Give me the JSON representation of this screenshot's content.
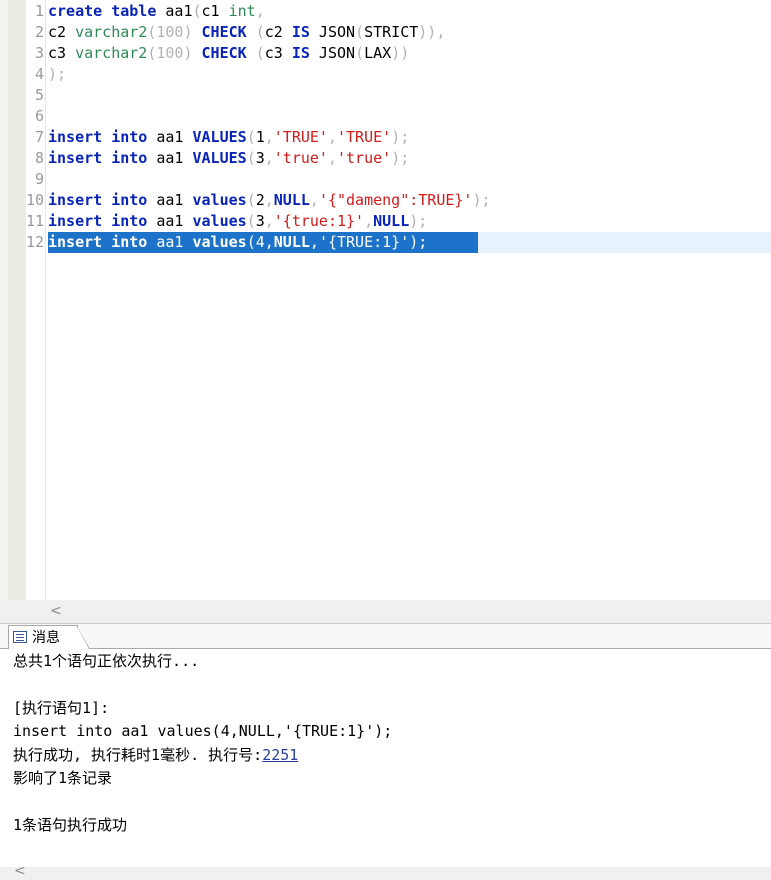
{
  "editor": {
    "lines": [
      {
        "num": "1",
        "tokens": [
          {
            "t": "create",
            "c": "kw"
          },
          {
            "t": " ",
            "c": ""
          },
          {
            "t": "table",
            "c": "kw"
          },
          {
            "t": " aa1",
            "c": ""
          },
          {
            "t": "(",
            "c": "pu"
          },
          {
            "t": "c1 ",
            "c": ""
          },
          {
            "t": "int",
            "c": "ty"
          },
          {
            "t": ",",
            "c": "pu"
          }
        ]
      },
      {
        "num": "2",
        "tokens": [
          {
            "t": "c2 ",
            "c": ""
          },
          {
            "t": "varchar2",
            "c": "ty"
          },
          {
            "t": "(100) ",
            "c": "pu"
          },
          {
            "t": "CHECK",
            "c": "kw"
          },
          {
            "t": " (",
            "c": "pu"
          },
          {
            "t": "c2 ",
            "c": ""
          },
          {
            "t": "IS",
            "c": "kw"
          },
          {
            "t": " JSON",
            "c": ""
          },
          {
            "t": "(",
            "c": "pu"
          },
          {
            "t": "STRICT",
            "c": ""
          },
          {
            "t": ")),",
            "c": "pu"
          }
        ]
      },
      {
        "num": "3",
        "tokens": [
          {
            "t": "c3 ",
            "c": ""
          },
          {
            "t": "varchar2",
            "c": "ty"
          },
          {
            "t": "(100) ",
            "c": "pu"
          },
          {
            "t": "CHECK",
            "c": "kw"
          },
          {
            "t": " (",
            "c": "pu"
          },
          {
            "t": "c3 ",
            "c": ""
          },
          {
            "t": "IS",
            "c": "kw"
          },
          {
            "t": " JSON",
            "c": ""
          },
          {
            "t": "(",
            "c": "pu"
          },
          {
            "t": "LAX",
            "c": ""
          },
          {
            "t": "))",
            "c": "pu"
          }
        ]
      },
      {
        "num": "4",
        "tokens": [
          {
            "t": ");",
            "c": "pu"
          }
        ]
      },
      {
        "num": "5",
        "tokens": []
      },
      {
        "num": "6",
        "tokens": []
      },
      {
        "num": "7",
        "tokens": [
          {
            "t": "insert",
            "c": "kw"
          },
          {
            "t": " ",
            "c": ""
          },
          {
            "t": "into",
            "c": "kw"
          },
          {
            "t": " aa1 ",
            "c": ""
          },
          {
            "t": "VALUES",
            "c": "kw"
          },
          {
            "t": "(",
            "c": "pu"
          },
          {
            "t": "1",
            "c": ""
          },
          {
            "t": ",",
            "c": "pu"
          },
          {
            "t": "'TRUE'",
            "c": "st"
          },
          {
            "t": ",",
            "c": "pu"
          },
          {
            "t": "'TRUE'",
            "c": "st"
          },
          {
            "t": ");",
            "c": "pu"
          }
        ]
      },
      {
        "num": "8",
        "tokens": [
          {
            "t": "insert",
            "c": "kw"
          },
          {
            "t": " ",
            "c": ""
          },
          {
            "t": "into",
            "c": "kw"
          },
          {
            "t": " aa1 ",
            "c": ""
          },
          {
            "t": "VALUES",
            "c": "kw"
          },
          {
            "t": "(",
            "c": "pu"
          },
          {
            "t": "3",
            "c": ""
          },
          {
            "t": ",",
            "c": "pu"
          },
          {
            "t": "'true'",
            "c": "st"
          },
          {
            "t": ",",
            "c": "pu"
          },
          {
            "t": "'true'",
            "c": "st"
          },
          {
            "t": ");",
            "c": "pu"
          }
        ]
      },
      {
        "num": "9",
        "tokens": []
      },
      {
        "num": "10",
        "tokens": [
          {
            "t": "insert",
            "c": "kw"
          },
          {
            "t": " ",
            "c": ""
          },
          {
            "t": "into",
            "c": "kw"
          },
          {
            "t": " aa1 ",
            "c": ""
          },
          {
            "t": "values",
            "c": "kw"
          },
          {
            "t": "(",
            "c": "pu"
          },
          {
            "t": "2",
            "c": ""
          },
          {
            "t": ",",
            "c": "pu"
          },
          {
            "t": "NULL",
            "c": "kw"
          },
          {
            "t": ",",
            "c": "pu"
          },
          {
            "t": "'{\"dameng\":TRUE}'",
            "c": "st"
          },
          {
            "t": ");",
            "c": "pu"
          }
        ]
      },
      {
        "num": "11",
        "tokens": [
          {
            "t": "insert",
            "c": "kw"
          },
          {
            "t": " ",
            "c": ""
          },
          {
            "t": "into",
            "c": "kw"
          },
          {
            "t": " aa1 ",
            "c": ""
          },
          {
            "t": "values",
            "c": "kw"
          },
          {
            "t": "(",
            "c": "pu"
          },
          {
            "t": "3",
            "c": ""
          },
          {
            "t": ",",
            "c": "pu"
          },
          {
            "t": "'{true:1}'",
            "c": "st"
          },
          {
            "t": ",",
            "c": "pu"
          },
          {
            "t": "NULL",
            "c": "kw"
          },
          {
            "t": ");",
            "c": "pu"
          }
        ]
      },
      {
        "num": "12",
        "selected": true,
        "tokens": [
          {
            "t": "insert",
            "c": "kw"
          },
          {
            "t": " ",
            "c": ""
          },
          {
            "t": "into",
            "c": "kw"
          },
          {
            "t": " aa1 ",
            "c": ""
          },
          {
            "t": "values",
            "c": "kw"
          },
          {
            "t": "(",
            "c": ""
          },
          {
            "t": "4",
            "c": ""
          },
          {
            "t": ",",
            "c": ""
          },
          {
            "t": "NULL",
            "c": "kw"
          },
          {
            "t": ",",
            "c": ""
          },
          {
            "t": "'{TRUE:1}'",
            "c": ""
          },
          {
            "t": ");",
            "c": ""
          }
        ]
      }
    ]
  },
  "scroll": {
    "left_arrow": "<"
  },
  "messages_tab": {
    "label": "消息",
    "icon": "message-icon"
  },
  "messages": {
    "line1": "总共1个语句正依次执行...",
    "line2": "[执行语句1]:",
    "line3": "insert into aa1 values(4,NULL,'{TRUE:1}');",
    "line4_prefix": "执行成功, 执行耗时1毫秒. 执行号:",
    "line4_link": "2251",
    "line5": "影响了1条记录",
    "line6": "1条语句执行成功"
  }
}
